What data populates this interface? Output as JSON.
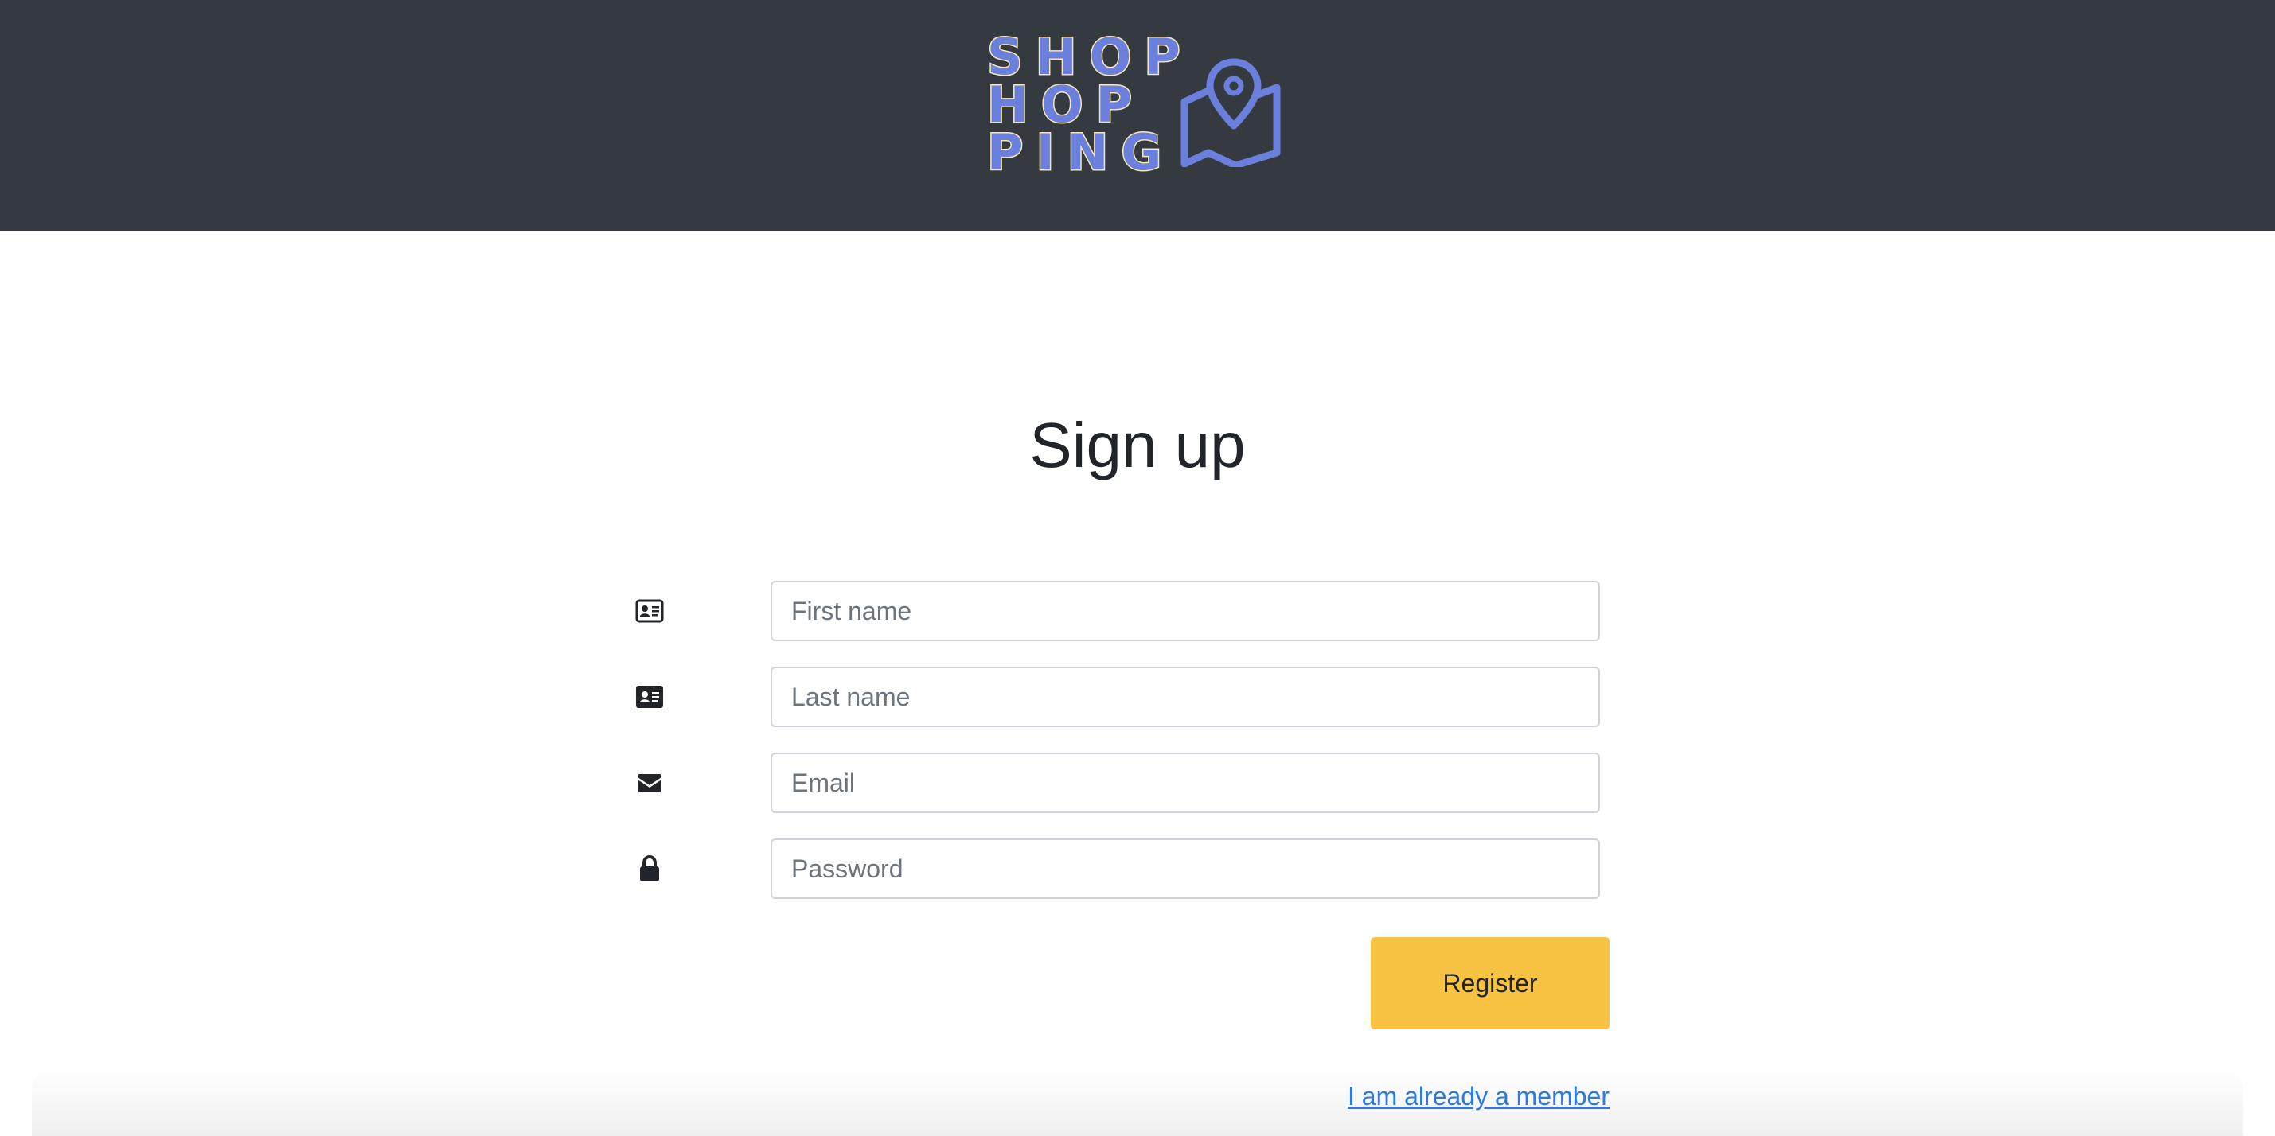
{
  "header": {
    "logo_lines": [
      "SHOP",
      "HOP",
      "PING"
    ],
    "logo_icon": "map-pin-icon",
    "background": "#343a40",
    "logo_color": "#6b7fdc"
  },
  "page": {
    "title": "Sign up"
  },
  "form": {
    "first_name": {
      "placeholder": "First name",
      "value": "",
      "icon": "id-card-outline-icon"
    },
    "last_name": {
      "placeholder": "Last name",
      "value": "",
      "icon": "id-card-solid-icon"
    },
    "email": {
      "placeholder": "Email",
      "value": "",
      "icon": "envelope-icon"
    },
    "password": {
      "placeholder": "Password",
      "value": "",
      "icon": "lock-icon"
    },
    "register_label": "Register",
    "register_color": "#f8c243",
    "member_link": "I am already a member",
    "link_color": "#2a7ae2"
  }
}
